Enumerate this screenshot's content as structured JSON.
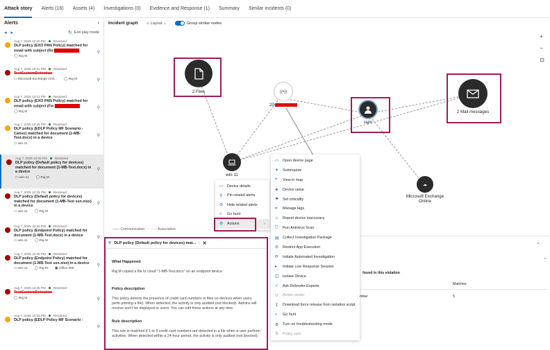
{
  "tabs": [
    "Attack story",
    "Alerts (16)",
    "Assets (4)",
    "Investigations (0)",
    "Evidence and Response (1)",
    "Summary",
    "Similar incidents (0)"
  ],
  "alerts_panel": {
    "title": "Alerts",
    "exit_label": "Exit play mode",
    "items": [
      {
        "time": "Aug 7, 2025 10:20 PM",
        "status": "Resolved",
        "title": "DLP policy (EXO PAN Policy) matched for email with subject (Re:",
        "user": "Raj M",
        "device": "",
        "extra": "",
        "sev": "orange"
      },
      {
        "time": "Aug 7, 2025 10:21 PM",
        "status": "Resolved",
        "title": "TestCustomDetection",
        "user": "Raj M",
        "device": "Microsoft Exchange Onli...",
        "extra": "",
        "sev": "red"
      },
      {
        "time": "Aug 7, 2025 10:21 PM",
        "status": "Resolved",
        "title": "DLP policy (EXO PAN Policy) matched for email with subject (Fw:",
        "user": "Raj M",
        "device": "",
        "extra": "",
        "sev": "orange"
      },
      {
        "time": "Aug 7, 2025 10:25 PM",
        "status": "Resolved",
        "title": "DLP policy (EDLP Policy MF Scenario - Canvo) matched for document (1-MB-Test.docx) in a device",
        "user": "",
        "device": "win-11",
        "extra": "",
        "sev": "orange"
      },
      {
        "time": "Aug 7, 2025 10:25 PM",
        "status": "Resolved",
        "title": "DLP policy (Default policy for devices) matched for document (1-MB-Test.docx) in a device",
        "user": "Raj M",
        "device": "win-11",
        "extra": "",
        "sev": "red"
      },
      {
        "time": "Aug 7, 2025 10:25 PM",
        "status": "Resolved",
        "title": "DLP policy (Default policy for devices) matched for document (1-MB-Test ssn.xlsx) in a device",
        "user": "Raj M",
        "device": "win-11",
        "extra": "",
        "sev": "red"
      },
      {
        "time": "Aug 7, 2025 10:25 PM",
        "status": "Resolved",
        "title": "DLP policy (Endpoint Policy) matched for document (1-MB-Test.docx) in a device",
        "user": "Raj M",
        "device": "win-11",
        "extra": "",
        "sev": "red"
      },
      {
        "time": "Aug 7, 2025 10:25 PM",
        "status": "Resolved",
        "title": "DLP policy (Endpoint Policy) matched for document (1-MB-Test ssn.xlsx) in a device",
        "user": "Raj M",
        "device": "win-11",
        "extra": "Office 365",
        "sev": "red"
      },
      {
        "time": "Aug 7, 2025 10:25 PM",
        "status": "Resolved",
        "title": "TestCustomDetection",
        "user": "Raj M",
        "device": "",
        "extra": "",
        "sev": "red"
      },
      {
        "time": "Aug 7, 2025 10:25 PM",
        "status": "Resolved",
        "title": "DLP policy (EDLP Policy MF Scenario -",
        "user": "",
        "device": "",
        "extra": "",
        "sev": "orange"
      }
    ]
  },
  "graph": {
    "title": "Incident graph",
    "layout_label": "Layout",
    "group_label": "Group similar nodes",
    "nodes": {
      "files": "2 Files",
      "ip": "20",
      "user": "rajm",
      "mail": "2 Mail messages",
      "device": "win-11",
      "cloud": "Microsoft Exchange Online"
    },
    "legend": [
      "Communication",
      "Association"
    ]
  },
  "menu1": [
    "Device details",
    "Pin related alerts",
    "Hide related alerts",
    "Go hunt",
    "Actions"
  ],
  "menu2": [
    {
      "label": "Open device page",
      "icon": "device-icon",
      "disabled": false
    },
    {
      "label": "Summarize",
      "icon": "sparkle-icon",
      "disabled": false
    },
    {
      "label": "View in map",
      "icon": "map-icon",
      "disabled": false
    },
    {
      "label": "Device value",
      "icon": "value-icon",
      "disabled": false
    },
    {
      "label": "Set criticality",
      "icon": "criticality-icon",
      "disabled": false
    },
    {
      "label": "Manage tags",
      "icon": "tag-icon",
      "disabled": false
    },
    {
      "label": "Report device inaccuracy",
      "icon": "report-icon",
      "disabled": false
    },
    {
      "label": "Run Antivirus Scan",
      "icon": "shield-icon",
      "disabled": false
    },
    {
      "label": "Collect Investigation Package",
      "icon": "package-icon",
      "disabled": false
    },
    {
      "label": "Restrict App Execution",
      "icon": "restrict-icon",
      "disabled": false
    },
    {
      "label": "Initiate Automated Investigation",
      "icon": "investigate-icon",
      "disabled": false
    },
    {
      "label": "Initiate Live Response Session",
      "icon": "terminal-icon",
      "disabled": false
    },
    {
      "label": "Isolate Device",
      "icon": "isolate-icon",
      "disabled": false
    },
    {
      "label": "Ask Defender Experts",
      "icon": "expert-icon",
      "disabled": false
    },
    {
      "label": "Action center",
      "icon": "action-center-icon",
      "disabled": true
    },
    {
      "label": "Download force release from isolation script",
      "icon": "download-icon",
      "disabled": false
    },
    {
      "label": "Go hunt",
      "icon": "hunt-icon",
      "disabled": false
    },
    {
      "label": "Turn on troubleshooting mode",
      "icon": "troubleshoot-icon",
      "disabled": false
    },
    {
      "label": "Policy sync",
      "icon": "sync-icon",
      "disabled": true
    }
  ],
  "detail": {
    "title": "DLP policy (Default policy for devices) mat...",
    "what_happened_h": "What Happened",
    "what_happened": "Raj M copied a file to cloud \"1-MB-Test.docx\" on an endpoint device.",
    "policy_h": "Policy description",
    "policy": "This policy detects the presence of credit card numbers in files on devices when users perfo printing a file). When detected, the activity is only audited (not blocked). Admins will receive won't be displayed to users. You can edit these actions at any time.",
    "rule_h": "Rule description",
    "rule": "This rule is matched if 1 to 9 credit card numbers are detected in a file when a user perform activities. When detected within a 24-hour period, the activity is only audited (not blocked)."
  },
  "right_panel": {
    "found_text": "found in this violation",
    "col_matches": "Matches",
    "row_label": "mber",
    "row_value": "5"
  }
}
